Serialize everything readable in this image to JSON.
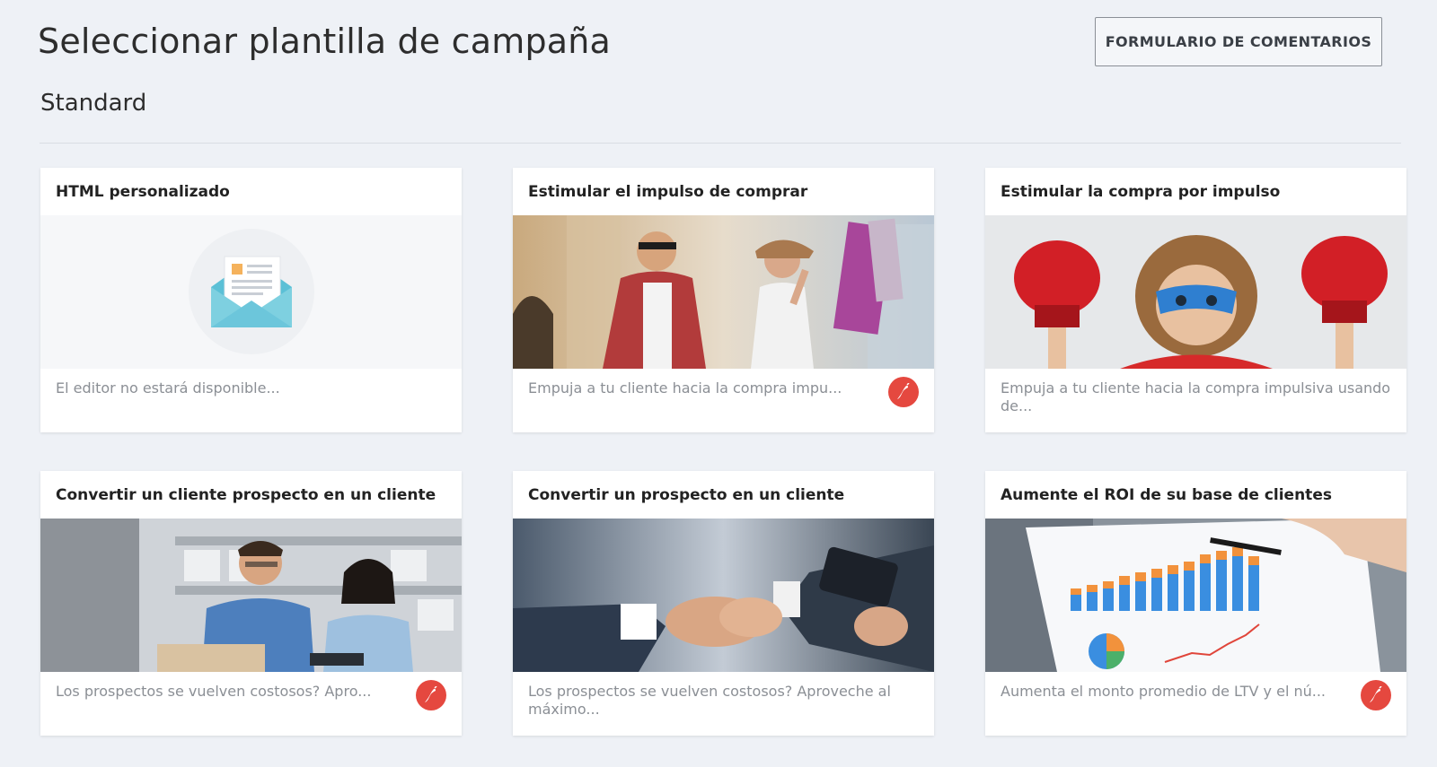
{
  "header": {
    "title": "Seleccionar plantilla de campaña",
    "feedback_button": "FORMULARIO DE COMENTARIOS"
  },
  "section": {
    "title": "Standard"
  },
  "cards": [
    {
      "title": "HTML personalizado",
      "description": "El editor no estará disponible...",
      "hot": false,
      "image": "envelope-icon"
    },
    {
      "title": "Estimular el impulso de comprar",
      "description": "Empuja a tu cliente hacia la compra impu...",
      "hot": true,
      "image": "shopping-couple-photo"
    },
    {
      "title": "Estimular la compra por impulso",
      "description": "Empuja a tu cliente hacia la compra impulsiva usando de...",
      "hot": false,
      "image": "superhero-kid-photo"
    },
    {
      "title": "Convertir un cliente prospecto en un cliente",
      "description": "Los prospectos se vuelven costosos? Apro...",
      "hot": true,
      "image": "warehouse-team-photo"
    },
    {
      "title": "Convertir un prospecto en un cliente",
      "description": "Los prospectos se vuelven costosos? Aproveche al máximo...",
      "hot": false,
      "image": "handshake-photo"
    },
    {
      "title": "Aumente el ROI de su base de clientes",
      "description": "Aumenta el monto promedio de LTV y el nú...",
      "hot": true,
      "image": "charts-report-photo"
    }
  ],
  "colors": {
    "background": "#eef1f6",
    "hot_badge": "#e5483f",
    "card": "#ffffff"
  }
}
